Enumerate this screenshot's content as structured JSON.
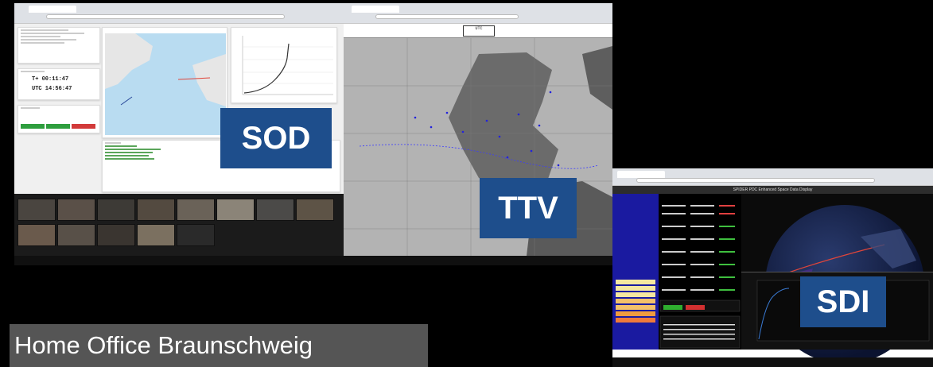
{
  "labels": {
    "sod": "SOD",
    "ttv": "TTV",
    "sdi": "SDI",
    "caption": "Home Office Braunschweig"
  },
  "sod": {
    "mission_time": "T+  00:11:47",
    "utc_time": "UTC  14:56:47"
  },
  "ttv": {
    "utc_label": "UTC"
  },
  "sdi": {
    "title": "SPIDER PDC Enhanced Space Data Display"
  },
  "colors": {
    "label_bg": "#1e4e8c",
    "caption_bg": "#555555",
    "sdi_panel": "#1a1aa0",
    "trajectory": "#e0453a"
  }
}
